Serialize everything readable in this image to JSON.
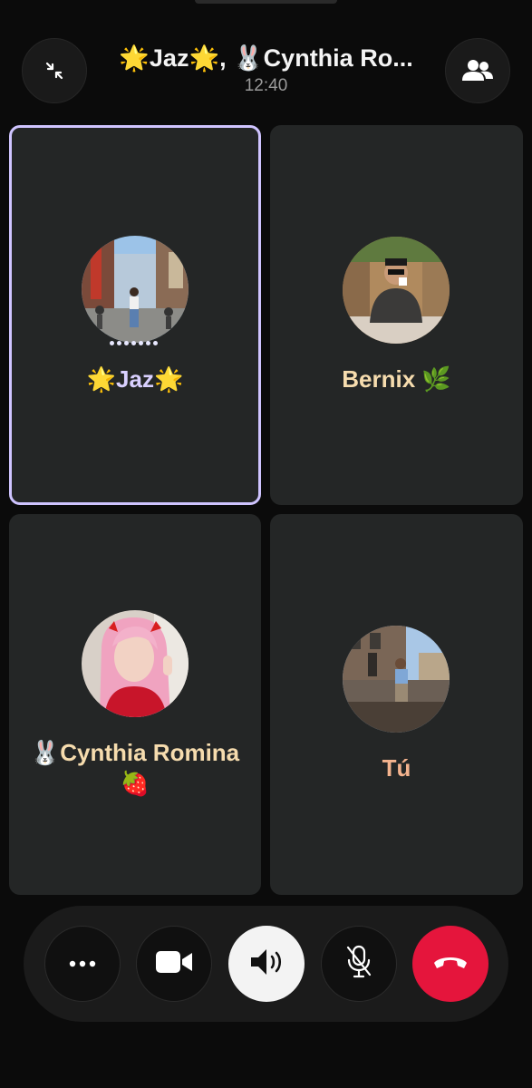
{
  "header": {
    "title": "🌟Jaz🌟, 🐰Cynthia Ro...",
    "time": "12:40"
  },
  "participants": [
    {
      "name": "🌟Jaz🌟",
      "active": true,
      "typing": true
    },
    {
      "name": "Bernix 🌿",
      "active": false
    },
    {
      "name": "🐰Cynthia Romina 🍓",
      "active": false
    },
    {
      "name": "Tú",
      "active": false
    }
  ],
  "controls": {
    "icons": [
      "more-icon",
      "video-camera-icon",
      "speaker-icon",
      "mic-off-icon",
      "hang-up-icon"
    ]
  },
  "colors": {
    "active_border": "#cfc4ff",
    "end_call": "#e5153c",
    "tile_bg": "#242626"
  }
}
